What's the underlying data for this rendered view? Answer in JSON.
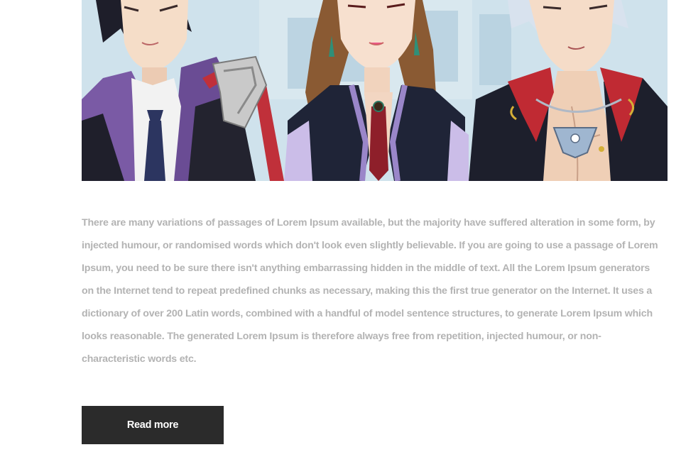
{
  "post": {
    "image_alt": "anime-characters-image",
    "body": "There are many variations of passages of Lorem Ipsum available, but the majority have suffered alteration in some form, by injected humour, or randomised words which don't look even slightly believable. If you are going to use a passage of Lorem Ipsum, you need to be sure there isn't anything embarrassing hidden in the middle of text. All the Lorem Ipsum generators on the Internet tend to repeat predefined chunks as necessary, making this the first true generator on the Internet. It uses a dictionary of over 200 Latin words, combined with a handful of model sentence structures, to generate Lorem Ipsum which looks reasonable. The generated Lorem Ipsum is therefore always free from repetition, injected humour, or non-characteristic words etc.",
    "read_more_label": "Read more"
  },
  "colors": {
    "text": "#b3b3b3",
    "button_bg": "#2b2b2b",
    "button_text": "#ffffff"
  }
}
